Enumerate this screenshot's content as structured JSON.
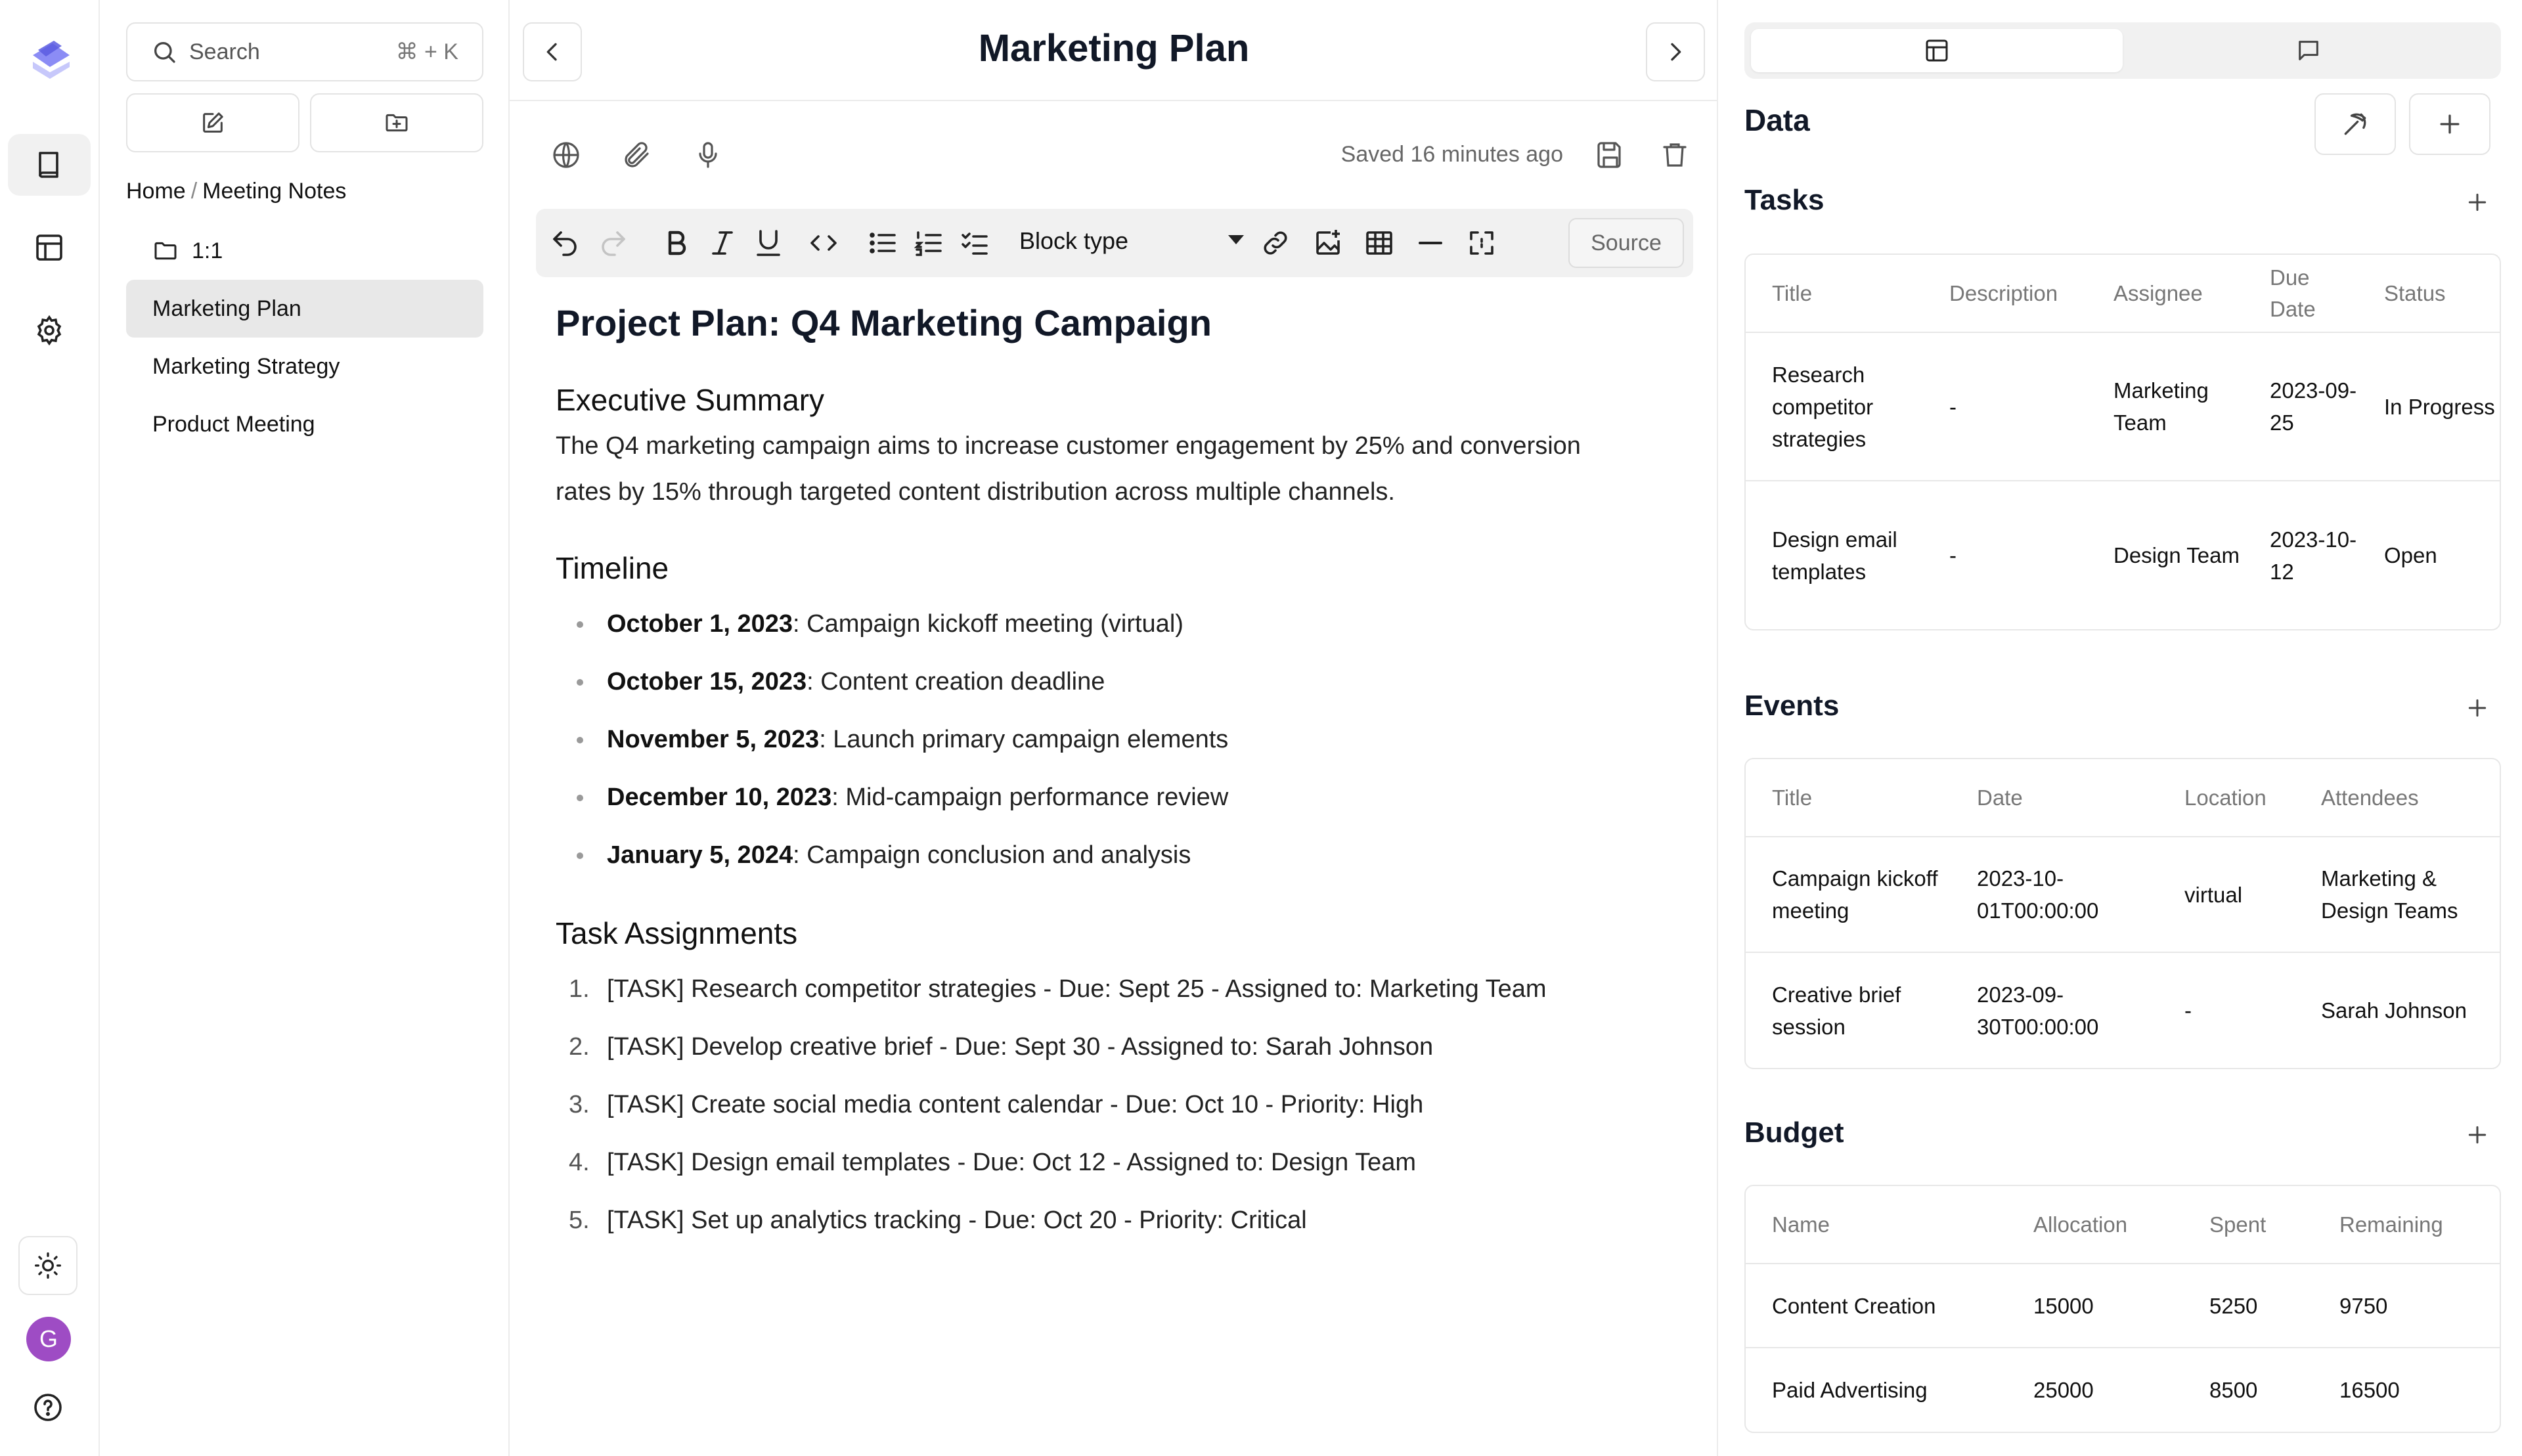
{
  "sidebar": {
    "search_placeholder": "Search",
    "search_shortcut": "⌘ + K",
    "breadcrumb": [
      "Home",
      "Meeting Notes"
    ],
    "breadcrumb_sep": "/",
    "folder": "1:1",
    "items": [
      "Marketing Plan",
      "Marketing Strategy",
      "Product Meeting"
    ],
    "active_item": "Marketing Plan"
  },
  "user": {
    "initial": "G",
    "avatar_color": "#9e4cc4"
  },
  "main": {
    "title": "Marketing Plan",
    "saved_status": "Saved 16 minutes ago",
    "toolbar": {
      "block_type": "Block type",
      "source_label": "Source"
    },
    "doc": {
      "h1": "Project Plan: Q4 Marketing Campaign",
      "summary_heading": "Executive Summary",
      "summary_line1": "The Q4 marketing campaign aims to increase customer engagement by 25% and conversion",
      "summary_line2": "rates by 15% through targeted content distribution across multiple channels.",
      "timeline_heading": "Timeline",
      "timeline": [
        {
          "date": "October 1, 2023",
          "text": ": Campaign kickoff meeting (virtual)"
        },
        {
          "date": "October 15, 2023",
          "text": ": Content creation deadline"
        },
        {
          "date": "November 5, 2023",
          "text": ": Launch primary campaign elements"
        },
        {
          "date": "December 10, 2023",
          "text": ": Mid-campaign performance review"
        },
        {
          "date": "January 5, 2024",
          "text": ": Campaign conclusion and analysis"
        }
      ],
      "tasks_heading": "Task Assignments",
      "tasks": [
        {
          "num": "1.",
          "text": "[TASK] Research competitor strategies - Due: Sept 25 - Assigned to: Marketing Team"
        },
        {
          "num": "2.",
          "text": "[TASK] Develop creative brief - Due: Sept 30 - Assigned to: Sarah Johnson"
        },
        {
          "num": "3.",
          "text": "[TASK] Create social media content calendar - Due: Oct 10 - Priority: High"
        },
        {
          "num": "4.",
          "text": "[TASK] Design email templates - Due: Oct 12 - Assigned to: Design Team"
        },
        {
          "num": "5.",
          "text": "[TASK] Set up analytics tracking - Due: Oct 20 - Priority: Critical"
        }
      ]
    }
  },
  "panel": {
    "title": "Data",
    "tasks": {
      "title": "Tasks",
      "headers": [
        "Title",
        "Description",
        "Assignee",
        "Due Date",
        "Status"
      ],
      "rows": [
        [
          "Research competitor strategies",
          "-",
          "Marketing Team",
          "2023-09-25",
          "In Progress"
        ],
        [
          "Design email templates",
          "-",
          "Design Team",
          "2023-10-12",
          "Open"
        ]
      ]
    },
    "events": {
      "title": "Events",
      "headers": [
        "Title",
        "Date",
        "Location",
        "Attendees"
      ],
      "rows": [
        [
          "Campaign kickoff meeting",
          "2023-10-01T00:00:00",
          "virtual",
          "Marketing & Design Teams"
        ],
        [
          "Creative brief session",
          "2023-09-30T00:00:00",
          "-",
          "Sarah Johnson"
        ]
      ]
    },
    "budget": {
      "title": "Budget",
      "headers": [
        "Name",
        "Allocation",
        "Spent",
        "Remaining"
      ],
      "rows": [
        [
          "Content Creation",
          "15000",
          "5250",
          "9750"
        ],
        [
          "Paid Advertising",
          "25000",
          "8500",
          "16500"
        ]
      ]
    }
  }
}
